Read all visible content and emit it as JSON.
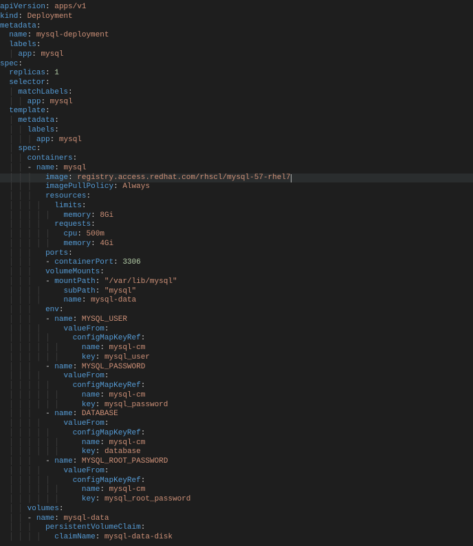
{
  "yaml": {
    "apiVersion": "apps/v1",
    "kind": "Deployment",
    "metadata": {
      "name": "mysql-deployment",
      "labels": {
        "app": "mysql"
      }
    },
    "spec": {
      "replicas": 1,
      "selector": {
        "matchLabels": {
          "app": "mysql"
        }
      },
      "template": {
        "metadata": {
          "labels": {
            "app": "mysql"
          }
        },
        "spec": {
          "containers": [
            {
              "name": "mysql",
              "image": "registry.access.redhat.com/rhscl/mysql-57-rhel7",
              "imagePullPolicy": "Always",
              "resources": {
                "limits": {
                  "memory": "8Gi"
                },
                "requests": {
                  "cpu": "500m",
                  "memory": "4Gi"
                }
              },
              "ports": [
                {
                  "containerPort": 3306
                }
              ],
              "volumeMounts": [
                {
                  "mountPath": "\"/var/lib/mysql\"",
                  "subPath": "\"mysql\"",
                  "name": "mysql-data"
                }
              ],
              "env": [
                {
                  "name": "MYSQL_USER",
                  "valueFrom": {
                    "configMapKeyRef": {
                      "name": "mysql-cm",
                      "key": "mysql_user"
                    }
                  }
                },
                {
                  "name": "MYSQL_PASSWORD",
                  "valueFrom": {
                    "configMapKeyRef": {
                      "name": "mysql-cm",
                      "key": "mysql_password"
                    }
                  }
                },
                {
                  "name": "DATABASE",
                  "valueFrom": {
                    "configMapKeyRef": {
                      "name": "mysql-cm",
                      "key": "database"
                    }
                  }
                },
                {
                  "name": "MYSQL_ROOT_PASSWORD",
                  "valueFrom": {
                    "configMapKeyRef": {
                      "name": "mysql-cm",
                      "key": "mysql_root_password"
                    }
                  }
                }
              ]
            }
          ],
          "volumes": [
            {
              "name": "mysql-data",
              "persistentVolumeClaim": {
                "claimName": "mysql-data-disk"
              }
            }
          ]
        }
      }
    }
  },
  "cursor_line_index": 18,
  "lines": [
    {
      "indent": 0,
      "guides": "",
      "dash": false,
      "key": "apiVersion",
      "has_colon": true,
      "val": "apps/v1",
      "val_kind": "str"
    },
    {
      "indent": 0,
      "guides": "",
      "dash": false,
      "key": "kind",
      "has_colon": true,
      "val": "Deployment",
      "val_kind": "str"
    },
    {
      "indent": 0,
      "guides": "",
      "dash": false,
      "key": "metadata",
      "has_colon": true,
      "val": "",
      "val_kind": ""
    },
    {
      "indent": 1,
      "guides": "",
      "dash": false,
      "key": "name",
      "has_colon": true,
      "val": "mysql-deployment",
      "val_kind": "str"
    },
    {
      "indent": 1,
      "guides": "",
      "dash": false,
      "key": "labels",
      "has_colon": true,
      "val": "",
      "val_kind": ""
    },
    {
      "indent": 2,
      "guides": "|",
      "dash": false,
      "key": "app",
      "has_colon": true,
      "val": "mysql",
      "val_kind": "str"
    },
    {
      "indent": 0,
      "guides": "",
      "dash": false,
      "key": "spec",
      "has_colon": true,
      "val": "",
      "val_kind": ""
    },
    {
      "indent": 1,
      "guides": "",
      "dash": false,
      "key": "replicas",
      "has_colon": true,
      "val": "1",
      "val_kind": "num"
    },
    {
      "indent": 1,
      "guides": "",
      "dash": false,
      "key": "selector",
      "has_colon": true,
      "val": "",
      "val_kind": ""
    },
    {
      "indent": 2,
      "guides": "|",
      "dash": false,
      "key": "matchLabels",
      "has_colon": true,
      "val": "",
      "val_kind": ""
    },
    {
      "indent": 3,
      "guides": "||",
      "dash": false,
      "key": "app",
      "has_colon": true,
      "val": "mysql",
      "val_kind": "str"
    },
    {
      "indent": 1,
      "guides": "",
      "dash": false,
      "key": "template",
      "has_colon": true,
      "val": "",
      "val_kind": ""
    },
    {
      "indent": 2,
      "guides": "|",
      "dash": false,
      "key": "metadata",
      "has_colon": true,
      "val": "",
      "val_kind": ""
    },
    {
      "indent": 3,
      "guides": "||",
      "dash": false,
      "key": "labels",
      "has_colon": true,
      "val": "",
      "val_kind": ""
    },
    {
      "indent": 4,
      "guides": "|||",
      "dash": false,
      "key": "app",
      "has_colon": true,
      "val": "mysql",
      "val_kind": "str"
    },
    {
      "indent": 2,
      "guides": "|",
      "dash": false,
      "key": "spec",
      "has_colon": true,
      "val": "",
      "val_kind": ""
    },
    {
      "indent": 3,
      "guides": "||",
      "dash": false,
      "key": "containers",
      "has_colon": true,
      "val": "",
      "val_kind": ""
    },
    {
      "indent": 4,
      "guides": "||",
      "dash": true,
      "key": "name",
      "has_colon": true,
      "val": "mysql",
      "val_kind": "str"
    },
    {
      "indent": 5,
      "guides": "|||",
      "dash": false,
      "key": "image",
      "has_colon": true,
      "val": "registry.access.redhat.com/rhscl/mysql-57-rhel7",
      "val_kind": "str",
      "hl": true,
      "cursor_after": true
    },
    {
      "indent": 5,
      "guides": "|||",
      "dash": false,
      "key": "imagePullPolicy",
      "has_colon": true,
      "val": "Always",
      "val_kind": "str"
    },
    {
      "indent": 5,
      "guides": "|||",
      "dash": false,
      "key": "resources",
      "has_colon": true,
      "val": "",
      "val_kind": ""
    },
    {
      "indent": 6,
      "guides": "||||",
      "dash": false,
      "key": "limits",
      "has_colon": true,
      "val": "",
      "val_kind": ""
    },
    {
      "indent": 7,
      "guides": "|||||",
      "dash": false,
      "key": "memory",
      "has_colon": true,
      "val": "8Gi",
      "val_kind": "str"
    },
    {
      "indent": 6,
      "guides": "||||",
      "dash": false,
      "key": "requests",
      "has_colon": true,
      "val": "",
      "val_kind": ""
    },
    {
      "indent": 7,
      "guides": "|||||",
      "dash": false,
      "key": "cpu",
      "has_colon": true,
      "val": "500m",
      "val_kind": "str"
    },
    {
      "indent": 7,
      "guides": "|||||",
      "dash": false,
      "key": "memory",
      "has_colon": true,
      "val": "4Gi",
      "val_kind": "str"
    },
    {
      "indent": 5,
      "guides": "|||",
      "dash": false,
      "key": "ports",
      "has_colon": true,
      "val": "",
      "val_kind": ""
    },
    {
      "indent": 6,
      "guides": "|||",
      "dash": true,
      "key": "containerPort",
      "has_colon": true,
      "val": "3306",
      "val_kind": "num"
    },
    {
      "indent": 5,
      "guides": "|||",
      "dash": false,
      "key": "volumeMounts",
      "has_colon": true,
      "val": "",
      "val_kind": ""
    },
    {
      "indent": 6,
      "guides": "|||",
      "dash": true,
      "key": "mountPath",
      "has_colon": true,
      "val": "\"/var/lib/mysql\"",
      "val_kind": "str"
    },
    {
      "indent": 7,
      "guides": "||||",
      "dash": false,
      "key": "subPath",
      "has_colon": true,
      "val": "\"mysql\"",
      "val_kind": "str"
    },
    {
      "indent": 7,
      "guides": "||||",
      "dash": false,
      "key": "name",
      "has_colon": true,
      "val": "mysql-data",
      "val_kind": "str"
    },
    {
      "indent": 5,
      "guides": "|||",
      "dash": false,
      "key": "env",
      "has_colon": true,
      "val": "",
      "val_kind": ""
    },
    {
      "indent": 6,
      "guides": "|||",
      "dash": true,
      "key": "name",
      "has_colon": true,
      "val": "MYSQL_USER",
      "val_kind": "str"
    },
    {
      "indent": 7,
      "guides": "||||",
      "dash": false,
      "key": "valueFrom",
      "has_colon": true,
      "val": "",
      "val_kind": ""
    },
    {
      "indent": 8,
      "guides": "|||||",
      "dash": false,
      "key": "configMapKeyRef",
      "has_colon": true,
      "val": "",
      "val_kind": ""
    },
    {
      "indent": 9,
      "guides": "||||||",
      "dash": false,
      "key": "name",
      "has_colon": true,
      "val": "mysql-cm",
      "val_kind": "str"
    },
    {
      "indent": 9,
      "guides": "||||||",
      "dash": false,
      "key": "key",
      "has_colon": true,
      "val": "mysql_user",
      "val_kind": "str"
    },
    {
      "indent": 6,
      "guides": "|||",
      "dash": true,
      "key": "name",
      "has_colon": true,
      "val": "MYSQL_PASSWORD",
      "val_kind": "str"
    },
    {
      "indent": 7,
      "guides": "||||",
      "dash": false,
      "key": "valueFrom",
      "has_colon": true,
      "val": "",
      "val_kind": ""
    },
    {
      "indent": 8,
      "guides": "|||||",
      "dash": false,
      "key": "configMapKeyRef",
      "has_colon": true,
      "val": "",
      "val_kind": ""
    },
    {
      "indent": 9,
      "guides": "||||||",
      "dash": false,
      "key": "name",
      "has_colon": true,
      "val": "mysql-cm",
      "val_kind": "str"
    },
    {
      "indent": 9,
      "guides": "||||||",
      "dash": false,
      "key": "key",
      "has_colon": true,
      "val": "mysql_password",
      "val_kind": "str"
    },
    {
      "indent": 6,
      "guides": "|||",
      "dash": true,
      "key": "name",
      "has_colon": true,
      "val": "DATABASE",
      "val_kind": "str"
    },
    {
      "indent": 7,
      "guides": "||||",
      "dash": false,
      "key": "valueFrom",
      "has_colon": true,
      "val": "",
      "val_kind": ""
    },
    {
      "indent": 8,
      "guides": "|||||",
      "dash": false,
      "key": "configMapKeyRef",
      "has_colon": true,
      "val": "",
      "val_kind": ""
    },
    {
      "indent": 9,
      "guides": "||||||",
      "dash": false,
      "key": "name",
      "has_colon": true,
      "val": "mysql-cm",
      "val_kind": "str"
    },
    {
      "indent": 9,
      "guides": "||||||",
      "dash": false,
      "key": "key",
      "has_colon": true,
      "val": "database",
      "val_kind": "str"
    },
    {
      "indent": 6,
      "guides": "|||",
      "dash": true,
      "key": "name",
      "has_colon": true,
      "val": "MYSQL_ROOT_PASSWORD",
      "val_kind": "str"
    },
    {
      "indent": 7,
      "guides": "||||",
      "dash": false,
      "key": "valueFrom",
      "has_colon": true,
      "val": "",
      "val_kind": ""
    },
    {
      "indent": 8,
      "guides": "|||||",
      "dash": false,
      "key": "configMapKeyRef",
      "has_colon": true,
      "val": "",
      "val_kind": ""
    },
    {
      "indent": 9,
      "guides": "||||||",
      "dash": false,
      "key": "name",
      "has_colon": true,
      "val": "mysql-cm",
      "val_kind": "str"
    },
    {
      "indent": 9,
      "guides": "||||||",
      "dash": false,
      "key": "key",
      "has_colon": true,
      "val": "mysql_root_password",
      "val_kind": "str"
    },
    {
      "indent": 3,
      "guides": "||",
      "dash": false,
      "key": "volumes",
      "has_colon": true,
      "val": "",
      "val_kind": ""
    },
    {
      "indent": 4,
      "guides": "||",
      "dash": true,
      "key": "name",
      "has_colon": true,
      "val": "mysql-data",
      "val_kind": "str"
    },
    {
      "indent": 5,
      "guides": "|||",
      "dash": false,
      "key": "persistentVolumeClaim",
      "has_colon": true,
      "val": "",
      "val_kind": ""
    },
    {
      "indent": 6,
      "guides": "||||",
      "dash": false,
      "key": "claimName",
      "has_colon": true,
      "val": "mysql-data-disk",
      "val_kind": "str"
    }
  ]
}
